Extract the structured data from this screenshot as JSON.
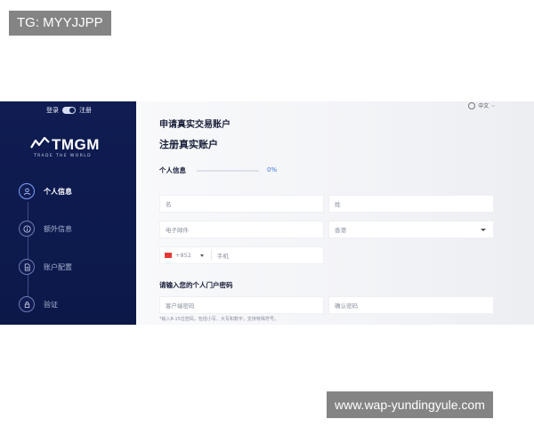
{
  "watermarks": {
    "top": "TG: MYYJJPP",
    "bottom": "www.wap-yundingyule.com"
  },
  "sidebar": {
    "toggle": {
      "left_label": "登录",
      "right_label": "注册",
      "state": "on"
    },
    "logo": {
      "word": "TMGM",
      "tagline": "TRADE THE WORLD"
    },
    "steps": [
      {
        "label": "个人信息",
        "icon": "user-icon",
        "active": true
      },
      {
        "label": "额外信息",
        "icon": "info-icon",
        "active": false
      },
      {
        "label": "账户配置",
        "icon": "document-icon",
        "active": false
      },
      {
        "label": "验证",
        "icon": "lock-icon",
        "active": false
      }
    ]
  },
  "header": {
    "language": "中文"
  },
  "form": {
    "title": "申请真实交易账户",
    "subtitle": "注册真实账户",
    "section_title": "个人信息",
    "progress_percent_label": "0%",
    "progress_value": 0,
    "fields": {
      "first_name_placeholder": "名",
      "last_name_placeholder": "姓",
      "email_placeholder": "电子邮件",
      "country_value": "香港",
      "country_code": "+852",
      "phone_placeholder": "手机"
    },
    "password_section_title": "请输入您的个人门户密码",
    "password_placeholder": "客户端密码",
    "confirm_password_placeholder": "确认密码",
    "password_hint": "*输入8-15位密码，包括小写、大写和数字，支持特殊符号。"
  },
  "colors": {
    "sidebar_bg": "#101c52",
    "accent": "#3f73e0",
    "flag": "#e53935"
  }
}
